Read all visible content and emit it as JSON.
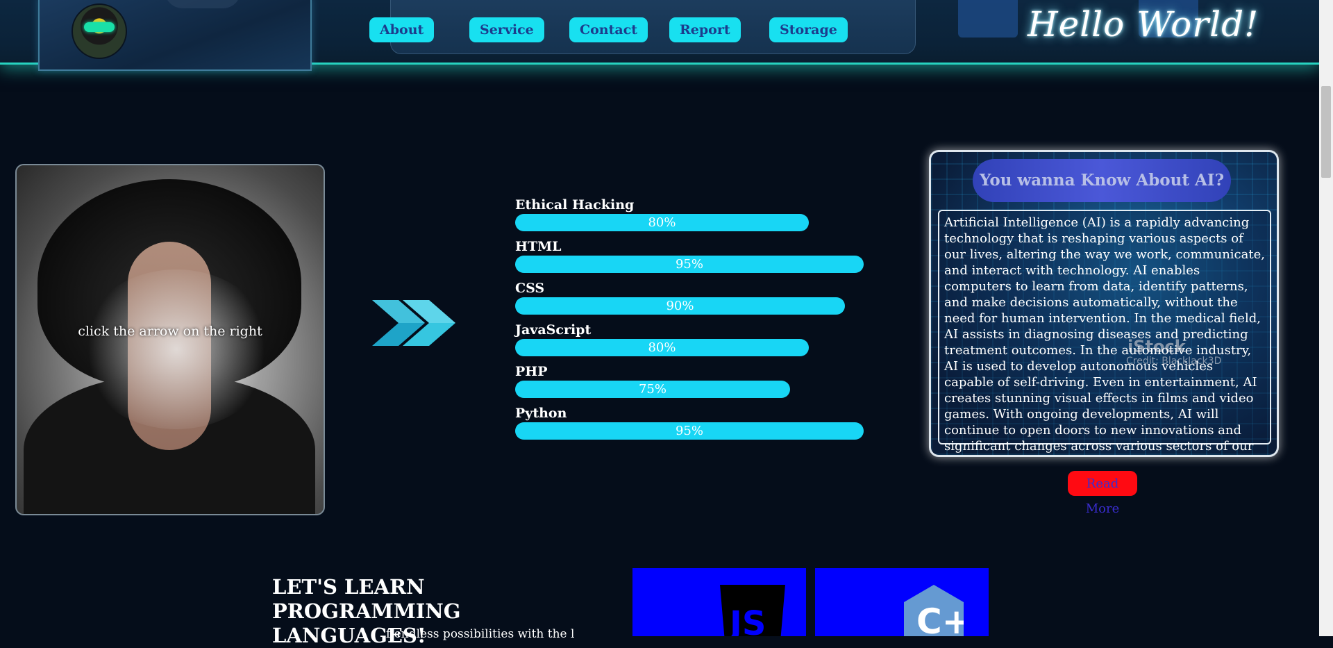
{
  "header": {
    "nav": [
      "About",
      "Service",
      "Contact",
      "Report",
      "Storage"
    ],
    "hello_text": "Hello World!",
    "accent_color": "#18e0f0"
  },
  "hero": {
    "caption": "click the arrow on the right",
    "arrow_icon": "double-chevron-right-icon"
  },
  "skills": [
    {
      "name": "Ethical Hacking",
      "percent_label": "80%",
      "value": 80
    },
    {
      "name": "HTML",
      "percent_label": "95%",
      "value": 95
    },
    {
      "name": "CSS",
      "percent_label": "90%",
      "value": 90
    },
    {
      "name": "JavaScript",
      "percent_label": "80%",
      "value": 80
    },
    {
      "name": "PHP",
      "percent_label": "75%",
      "value": 75
    },
    {
      "name": "Python",
      "percent_label": "95%",
      "value": 95
    }
  ],
  "ai_card": {
    "title": "You wanna Know About AI?",
    "text": "Artificial Intelligence (AI) is a rapidly advancing technology that is reshaping various aspects of our lives, altering the way we work, communicate, and interact with technology. AI enables computers to learn from data, identify patterns, and make decisions automatically, without the need for human intervention. In the medical field, AI assists in diagnosing diseases and predicting treatment outcomes. In the automotive industry, AI is used to develop autonomous vehicles capable of self-driving. Even in entertainment, AI creates stunning visual effects in films and video games. With ongoing developments, AI will continue to open doors to new innovations and significant changes across various sectors of our lives.",
    "watermark": "iStock",
    "credit": "Credit: BlackJack3D",
    "read_more": "Read More",
    "read_more_color": "#ff0a12"
  },
  "learn": {
    "title": "LET'S LEARN PROGRAMMING LANGUAGES!",
    "subtitle": "f endless possibilities with the l",
    "cards": [
      {
        "label": "JS",
        "icon": "javascript-logo-icon"
      },
      {
        "label": "C++",
        "icon": "cpp-logo-icon"
      }
    ]
  }
}
